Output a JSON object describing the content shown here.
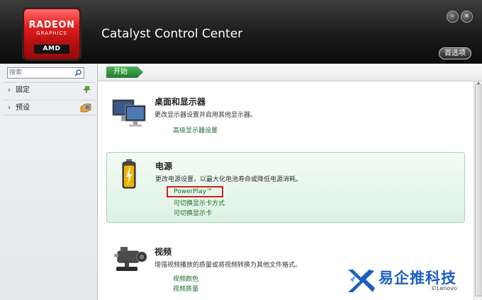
{
  "header": {
    "logo": {
      "line1": "RADEON",
      "line2": "GRAPHICS",
      "line3": "AMD"
    },
    "title": "Catalyst Control Center",
    "minimize_symbol": "–",
    "close_symbol": "×",
    "preferences_label": "首选项"
  },
  "sidebar": {
    "search": {
      "placeholder": "搜索",
      "icon": "search-icon"
    },
    "items": [
      {
        "label": "固定",
        "icon": "pin-icon"
      },
      {
        "label": "预设",
        "icon": "preset-tag-icon"
      }
    ]
  },
  "breadcrumb": {
    "label": "开始"
  },
  "sections": {
    "display": {
      "title": "桌面和显示器",
      "description": "更改显示器设置并启用其他显示器。",
      "links": [
        "高级显示器设置"
      ],
      "icon": "monitors-icon"
    },
    "power": {
      "title": "电源",
      "description": "更改电源设置，以最大化电池寿命或降低电源消耗。",
      "links": [
        "PowerPlay™",
        "可切换显示卡方式",
        "可切换显示卡"
      ],
      "icon": "battery-icon",
      "highlighted_link": "PowerPlay™"
    },
    "video": {
      "title": "视频",
      "description": "增强视频播放的质量或将视频转换为其他文件格式。",
      "links": [
        "视频颜色",
        "视频质量"
      ],
      "icon": "video-camera-icon"
    }
  },
  "watermark": {
    "text": "易企推科技",
    "brand": "©Lenovo"
  },
  "colors": {
    "header_bg": "#1b1b1b",
    "accent_green": "#207a2c",
    "link_green": "#1d6b2f",
    "highlight_red": "#d21e1e",
    "watermark_blue": "#1c5fbf"
  }
}
